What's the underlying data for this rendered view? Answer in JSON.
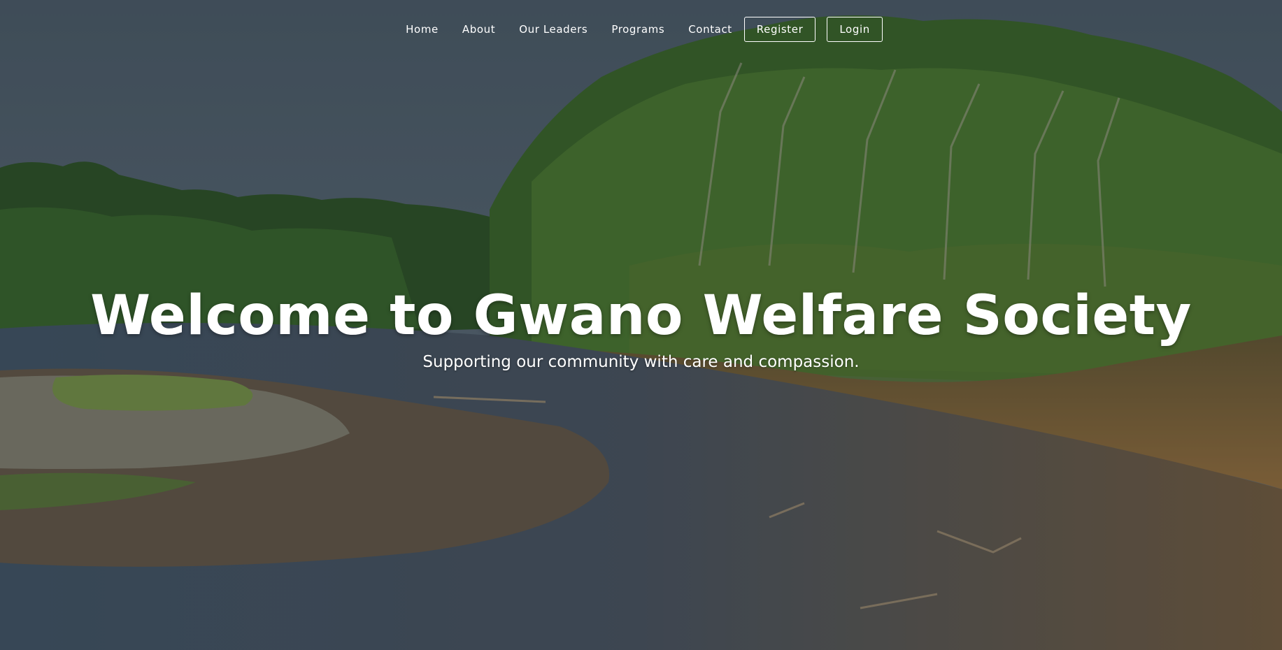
{
  "nav": {
    "links": [
      {
        "label": "Home"
      },
      {
        "label": "About"
      },
      {
        "label": "Our Leaders"
      },
      {
        "label": "Programs"
      },
      {
        "label": "Contact"
      }
    ],
    "register_label": "Register",
    "login_label": "Login"
  },
  "hero": {
    "title": "Welcome to Gwano Welfare Society",
    "subtitle": "Supporting our community with care and compassion."
  },
  "colors": {
    "text": "#ffffff",
    "sky": "#5a6b78",
    "foliage": "#3f6a2a",
    "water": "#4a5e6e",
    "bank": "#8a6a3c"
  }
}
